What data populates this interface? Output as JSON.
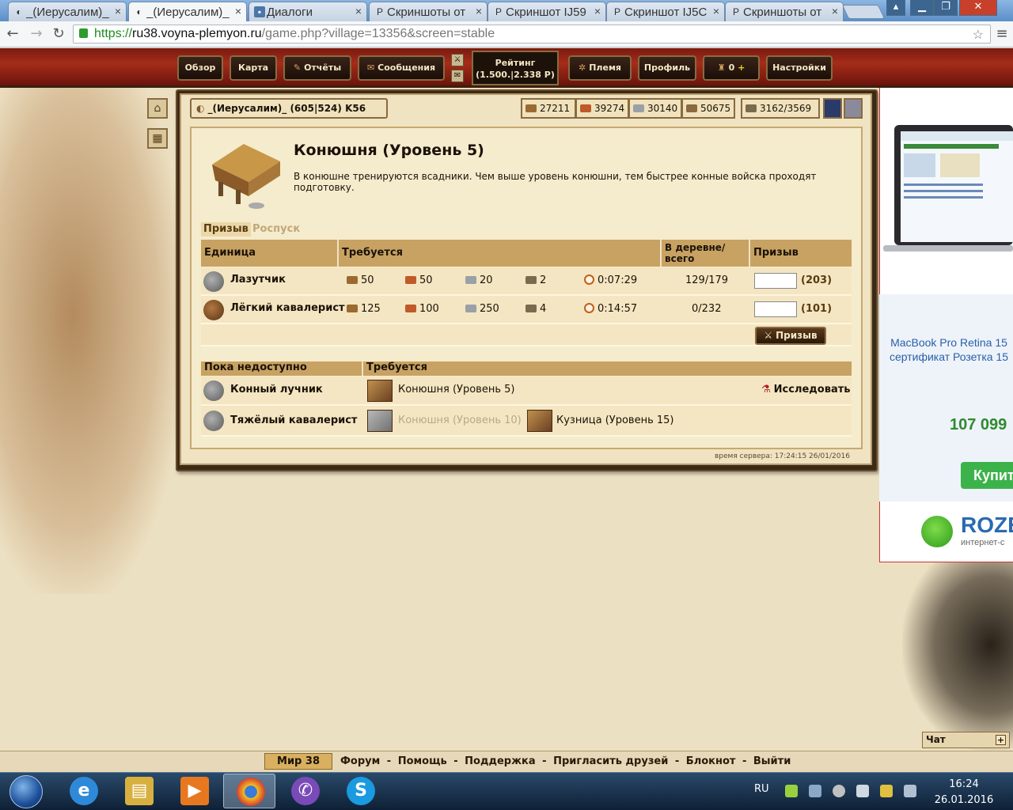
{
  "browser": {
    "tabs": [
      {
        "label": "_(Иерусалим)_",
        "icon": "game-favicon"
      },
      {
        "label": "_(Иерусалим)_",
        "icon": "game-favicon",
        "active": true
      },
      {
        "label": "Диалоги",
        "icon": "vk-favicon"
      },
      {
        "label": "Скриншоты от",
        "icon": "p-favicon",
        "glyph": "P"
      },
      {
        "label": "Скриншот IJ59",
        "icon": "p-favicon",
        "glyph": "P"
      },
      {
        "label": "Скриншот IJ5C",
        "icon": "p-favicon",
        "glyph": "P"
      },
      {
        "label": "Скриншоты от",
        "icon": "p-favicon",
        "glyph": "P"
      }
    ],
    "close_glyph": "×",
    "url_scheme": "https://",
    "url_host": "ru38.voyna-plemyon.ru",
    "url_path": "/game.php?village=13356&screen=stable"
  },
  "nav": {
    "overview": "Обзор",
    "map": "Карта",
    "reports": "Отчёты",
    "messages": "Сообщения",
    "rating_label": "Рейтинг",
    "rating_value": "(1.500.|2.338 P)",
    "tribe": "Племя",
    "profile": "Профиль",
    "premium_points": "0",
    "premium_plus": "+",
    "settings": "Настройки"
  },
  "village": {
    "name": "_(Иерусалим)_ (605|524) K56",
    "wood": "27211",
    "clay": "39274",
    "iron": "30140",
    "storage": "50675",
    "population": "3162/3569"
  },
  "building": {
    "title": "Конюшня (Уровень 5)",
    "description": "В конюшне тренируются всадники. Чем выше уровень конюшни, тем быстрее конные войска проходят подготовку."
  },
  "subtabs": {
    "recruit": "Призыв",
    "dismiss": "Роспуск"
  },
  "train_table": {
    "headers": {
      "unit": "Единица",
      "required": "Требуется",
      "in_village": "В деревне/ всего",
      "recruit": "Призыв"
    },
    "rows": [
      {
        "name": "Лазутчик",
        "wood": "50",
        "clay": "50",
        "iron": "20",
        "pop": "2",
        "time": "0:07:29",
        "count": "129/179",
        "max": "(203)",
        "horse": "gray"
      },
      {
        "name": "Лёгкий кавалерист",
        "wood": "125",
        "clay": "100",
        "iron": "250",
        "pop": "4",
        "time": "0:14:57",
        "count": "0/232",
        "max": "(101)",
        "horse": "brown"
      }
    ],
    "recruit_button": "Призыв"
  },
  "unavailable_table": {
    "headers": {
      "unit": "Пока недоступно",
      "required": "Требуется"
    },
    "rows": [
      {
        "name": "Конный лучник",
        "req1": "Конюшня (Уровень 5)",
        "req2": "",
        "research": "Исследовать"
      },
      {
        "name": "Тяжёлый кавалерист",
        "req1": "Конюшня (Уровень 10)",
        "req2": "Кузница (Уровень 15)",
        "research": ""
      }
    ]
  },
  "server_time": "время сервера: 17:24:15 26/01/2016",
  "ad": {
    "line1": "MacBook Pro Retina 15",
    "line2": "сертификат Розетка 15",
    "price": "107 099",
    "buy": "Купит",
    "brand": "ROZE",
    "brand_sub": "интернет-с"
  },
  "chat": {
    "label": "Чат",
    "plus": "+"
  },
  "footer": {
    "world": "Мир 38",
    "links": [
      "Форум",
      "-",
      "Помощь",
      "-",
      "Поддержка",
      "-",
      "Пригласить друзей",
      "-",
      "Блокнот",
      "-",
      "Выйти"
    ]
  },
  "taskbar": {
    "apps": [
      {
        "name": "internet-explorer",
        "glyph": "e",
        "color": "#2e8ad8"
      },
      {
        "name": "file-explorer",
        "glyph": "▤",
        "color": "#d8b040"
      },
      {
        "name": "media-player",
        "glyph": "▶",
        "color": "#e87820"
      },
      {
        "name": "chrome",
        "glyph": "●",
        "color": "#d84030"
      },
      {
        "name": "viber",
        "glyph": "✆",
        "color": "#7a4ab8"
      },
      {
        "name": "skype",
        "glyph": "S",
        "color": "#1a9ae0"
      }
    ],
    "active_index": 3,
    "lang": "RU",
    "time": "16:24",
    "date": "26.01.2016"
  },
  "colors": {
    "header_red": "#a52c1a",
    "parchment": "#ece0c2",
    "table_header": "#c8a262",
    "wood": "#9a6a30",
    "clay": "#c05a2a",
    "iron": "#9aa0a6",
    "pop": "#7a6a50"
  }
}
